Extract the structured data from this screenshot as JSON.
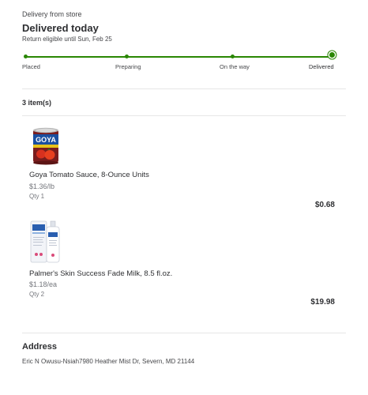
{
  "header": {
    "delivery_mode": "Delivery from store",
    "status_title": "Delivered today",
    "return_note": "Return eligible until Sun, Feb 25"
  },
  "tracker": {
    "steps": [
      "Placed",
      "Preparing",
      "On the way",
      "Delivered"
    ],
    "current_step": "Delivered",
    "accent_color": "#2a8703"
  },
  "items": {
    "count_label": "3 item(s)",
    "list": [
      {
        "name": "Goya Tomato Sauce, 8-Ounce Units",
        "unit_price": "$1.36/lb",
        "qty": "Qty 1",
        "price": "$0.68",
        "image_icon": "tomato-sauce-can"
      },
      {
        "name": "Palmer's Skin Success Fade Milk, 8.5 fl.oz.",
        "unit_price": "$1.18/ea",
        "qty": "Qty 2",
        "price": "$19.98",
        "image_icon": "lotion-bottle"
      }
    ]
  },
  "address": {
    "heading": "Address",
    "line": "Eric N Owusu-Nsiah7980 Heather Mist Dr, Severn, MD 21144"
  }
}
